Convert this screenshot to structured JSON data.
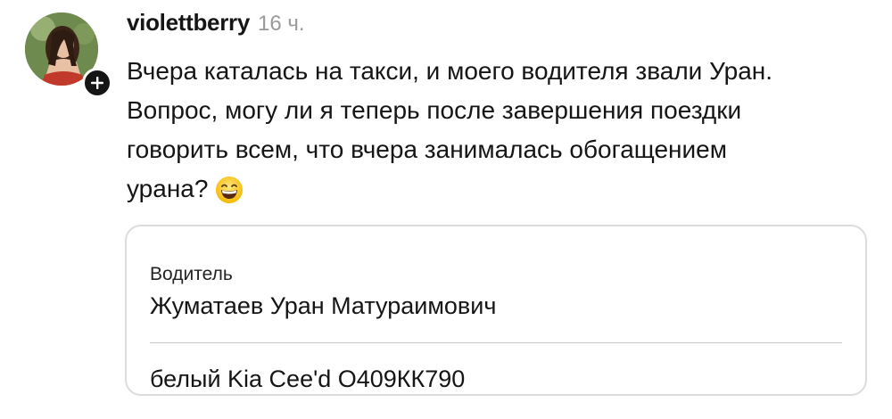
{
  "comment": {
    "username": "violettberry",
    "timestamp": "16 ч.",
    "avatar_icon": "user-avatar-photo",
    "follow_icon": "plus-icon",
    "text_lines": [
      "Вчера каталась на такси, и моего водителя звали Уран.",
      "Вопрос, могу ли я теперь после завершения поездки",
      "говорить всем, что вчера занималась обогащением",
      "урана?"
    ],
    "emoji_icon": "grinning-face-emoji"
  },
  "driver_card": {
    "label": "Водитель",
    "name": "Жуматаев Уран Матураимович",
    "car": "белый Kia Cee'd О409КК790"
  },
  "colors": {
    "text": "#151515",
    "muted": "#9a9a9a",
    "badge": "#151515",
    "card_border": "#dcdcdc"
  }
}
